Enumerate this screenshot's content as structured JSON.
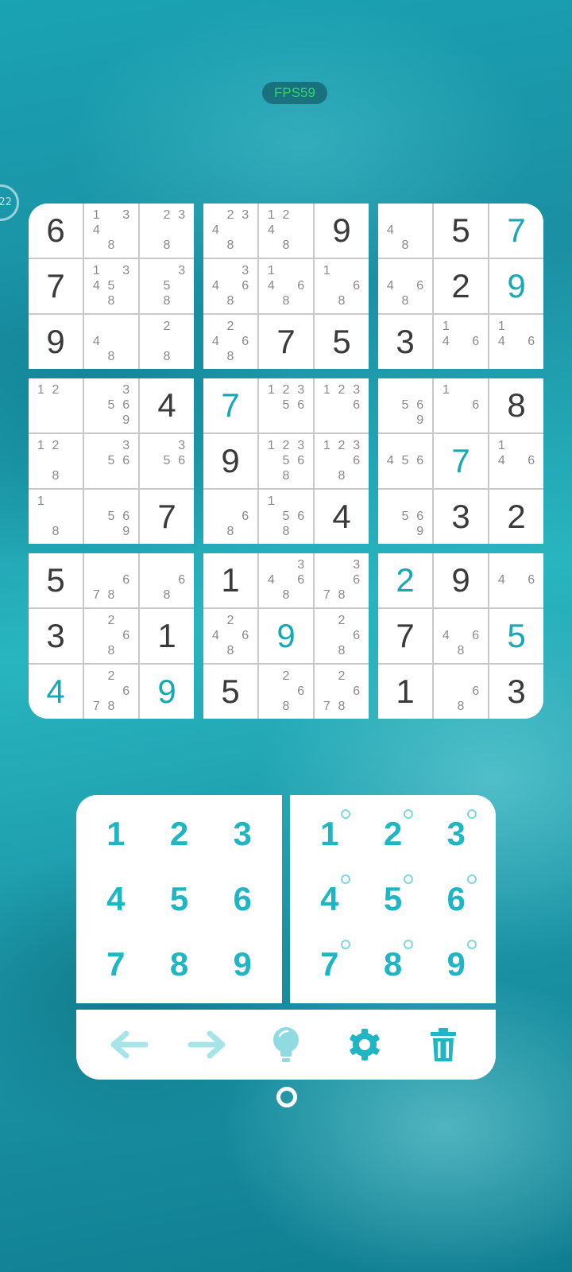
{
  "status": {
    "fps": "FPS59"
  },
  "side_handle": "22",
  "colors": {
    "given": "#3a3a3a",
    "user": "#15a9b4",
    "note": "#8a8a8a",
    "accent": "#1fb5c2"
  },
  "board": {
    "rows": [
      [
        {
          "v": "6",
          "k": "given"
        },
        {
          "n": [
            "1",
            "",
            "3",
            "4",
            "",
            "",
            "",
            "8",
            ""
          ]
        },
        {
          "n": [
            "",
            "2",
            "3",
            "",
            "",
            "",
            "",
            "8",
            ""
          ]
        },
        {
          "n": [
            "",
            "2",
            "3",
            "4",
            "",
            "",
            "",
            "8",
            ""
          ]
        },
        {
          "n": [
            "1",
            "2",
            "",
            "4",
            "",
            "",
            "",
            "8",
            ""
          ]
        },
        {
          "v": "9",
          "k": "given"
        },
        {
          "n": [
            "",
            "",
            "",
            "4",
            "",
            "",
            "",
            "8",
            ""
          ]
        },
        {
          "v": "5",
          "k": "given"
        },
        {
          "v": "7",
          "k": "user"
        }
      ],
      [
        {
          "v": "7",
          "k": "given"
        },
        {
          "n": [
            "1",
            "",
            "3",
            "4",
            "5",
            "",
            "",
            "8",
            ""
          ]
        },
        {
          "n": [
            "",
            "",
            "3",
            "",
            "5",
            "",
            "",
            "8",
            ""
          ]
        },
        {
          "n": [
            "",
            "",
            "3",
            "4",
            "",
            "6",
            "",
            "8",
            ""
          ]
        },
        {
          "n": [
            "1",
            "",
            "",
            "4",
            "",
            "6",
            "",
            "8",
            ""
          ]
        },
        {
          "n": [
            "1",
            "",
            "",
            "",
            "",
            "6",
            "",
            "8",
            ""
          ]
        },
        {
          "n": [
            "",
            "",
            "",
            "4",
            "",
            "6",
            "",
            "8",
            ""
          ]
        },
        {
          "v": "2",
          "k": "given"
        },
        {
          "v": "9",
          "k": "user"
        }
      ],
      [
        {
          "v": "9",
          "k": "given"
        },
        {
          "n": [
            "",
            "",
            "",
            "4",
            "",
            "",
            "",
            "8",
            ""
          ]
        },
        {
          "n": [
            "",
            "2",
            "",
            "",
            "",
            "",
            "",
            "8",
            ""
          ]
        },
        {
          "n": [
            "",
            "2",
            "",
            "4",
            "",
            "6",
            "",
            "8",
            ""
          ]
        },
        {
          "v": "7",
          "k": "given"
        },
        {
          "v": "5",
          "k": "given"
        },
        {
          "v": "3",
          "k": "given"
        },
        {
          "n": [
            "1",
            "",
            "",
            "4",
            "",
            "6",
            "",
            "",
            ""
          ]
        },
        {
          "n": [
            "1",
            "",
            "",
            "4",
            "",
            "6",
            "",
            "",
            ""
          ]
        }
      ],
      [
        {
          "n": [
            "1",
            "2",
            "",
            "",
            "",
            "",
            "",
            "",
            ""
          ]
        },
        {
          "n": [
            "",
            "",
            "3",
            "",
            "5",
            "6",
            "",
            "",
            "9"
          ]
        },
        {
          "v": "4",
          "k": "given"
        },
        {
          "v": "7",
          "k": "user"
        },
        {
          "n": [
            "1",
            "2",
            "3",
            "",
            "5",
            "6",
            "",
            "",
            ""
          ]
        },
        {
          "n": [
            "1",
            "2",
            "3",
            "",
            "",
            "6",
            "",
            "",
            ""
          ]
        },
        {
          "n": [
            "",
            "",
            "",
            "",
            "5",
            "6",
            "",
            "",
            "9"
          ]
        },
        {
          "n": [
            "1",
            "",
            "",
            "",
            "",
            "6",
            "",
            "",
            ""
          ]
        },
        {
          "v": "8",
          "k": "given"
        }
      ],
      [
        {
          "n": [
            "1",
            "2",
            "",
            "",
            "",
            "",
            "",
            "8",
            ""
          ]
        },
        {
          "n": [
            "",
            "",
            "3",
            "",
            "5",
            "6",
            "",
            "",
            ""
          ]
        },
        {
          "n": [
            "",
            "",
            "3",
            "",
            "5",
            "6",
            "",
            "",
            ""
          ]
        },
        {
          "v": "9",
          "k": "given"
        },
        {
          "n": [
            "1",
            "2",
            "3",
            "",
            "5",
            "6",
            "",
            "8",
            ""
          ]
        },
        {
          "n": [
            "1",
            "2",
            "3",
            "",
            "",
            "6",
            "",
            "8",
            ""
          ]
        },
        {
          "n": [
            "",
            "",
            "",
            "4",
            "5",
            "6",
            "",
            "",
            ""
          ]
        },
        {
          "v": "7",
          "k": "user"
        },
        {
          "n": [
            "1",
            "",
            "",
            "4",
            "",
            "6",
            "",
            "",
            ""
          ]
        }
      ],
      [
        {
          "n": [
            "1",
            "",
            "",
            "",
            "",
            "",
            "",
            "8",
            ""
          ]
        },
        {
          "n": [
            "",
            "",
            "",
            "",
            "5",
            "6",
            "",
            "",
            "9"
          ]
        },
        {
          "v": "7",
          "k": "given"
        },
        {
          "n": [
            "",
            "",
            "",
            "",
            "",
            "6",
            "",
            "8",
            ""
          ]
        },
        {
          "n": [
            "1",
            "",
            "",
            "",
            "5",
            "6",
            "",
            "8",
            ""
          ]
        },
        {
          "v": "4",
          "k": "given"
        },
        {
          "n": [
            "",
            "",
            "",
            "",
            "5",
            "6",
            "",
            "",
            "9"
          ]
        },
        {
          "v": "3",
          "k": "given"
        },
        {
          "v": "2",
          "k": "given"
        }
      ],
      [
        {
          "v": "5",
          "k": "given"
        },
        {
          "n": [
            "",
            "",
            "",
            "",
            "",
            "6",
            "7",
            "8",
            ""
          ]
        },
        {
          "n": [
            "",
            "",
            "",
            "",
            "",
            "6",
            "",
            "8",
            ""
          ]
        },
        {
          "v": "1",
          "k": "given"
        },
        {
          "n": [
            "",
            "",
            "3",
            "4",
            "",
            "6",
            "",
            "8",
            ""
          ]
        },
        {
          "n": [
            "",
            "",
            "3",
            "",
            "",
            "6",
            "7",
            "8",
            ""
          ]
        },
        {
          "v": "2",
          "k": "user"
        },
        {
          "v": "9",
          "k": "given"
        },
        {
          "n": [
            "",
            "",
            "",
            "4",
            "",
            "6",
            "",
            "",
            ""
          ]
        }
      ],
      [
        {
          "v": "3",
          "k": "given"
        },
        {
          "n": [
            "",
            "2",
            "",
            "",
            "",
            "6",
            "",
            "8",
            ""
          ]
        },
        {
          "v": "1",
          "k": "given"
        },
        {
          "n": [
            "",
            "2",
            "",
            "4",
            "",
            "6",
            "",
            "8",
            ""
          ]
        },
        {
          "v": "9",
          "k": "user"
        },
        {
          "n": [
            "",
            "2",
            "",
            "",
            "",
            "6",
            "",
            "8",
            ""
          ]
        },
        {
          "v": "7",
          "k": "given"
        },
        {
          "n": [
            "",
            "",
            "",
            "4",
            "",
            "6",
            "",
            "8",
            ""
          ]
        },
        {
          "v": "5",
          "k": "user"
        }
      ],
      [
        {
          "v": "4",
          "k": "user"
        },
        {
          "n": [
            "",
            "2",
            "",
            "",
            "",
            "6",
            "7",
            "8",
            ""
          ]
        },
        {
          "v": "9",
          "k": "user"
        },
        {
          "v": "5",
          "k": "given"
        },
        {
          "n": [
            "",
            "2",
            "",
            "",
            "",
            "6",
            "",
            "8",
            ""
          ]
        },
        {
          "n": [
            "",
            "2",
            "",
            "",
            "",
            "6",
            "7",
            "8",
            ""
          ]
        },
        {
          "v": "1",
          "k": "given"
        },
        {
          "n": [
            "",
            "",
            "",
            "",
            "",
            "6",
            "",
            "8",
            ""
          ]
        },
        {
          "v": "3",
          "k": "given"
        }
      ]
    ]
  },
  "numpad": {
    "digits": [
      "1",
      "2",
      "3",
      "4",
      "5",
      "6",
      "7",
      "8",
      "9"
    ],
    "notes": [
      "1",
      "2",
      "3",
      "4",
      "5",
      "6",
      "7",
      "8",
      "9"
    ]
  },
  "toolbar": {
    "items": [
      {
        "icon": "undo-arrow-icon",
        "color": "#a6e4e8"
      },
      {
        "icon": "redo-arrow-icon",
        "color": "#a6e4e8"
      },
      {
        "icon": "lightbulb-hint-icon",
        "color": "#8fdbe1"
      },
      {
        "icon": "gear-settings-icon",
        "color": "#1fb5c2"
      },
      {
        "icon": "trash-icon",
        "color": "#1fb5c2"
      }
    ]
  }
}
